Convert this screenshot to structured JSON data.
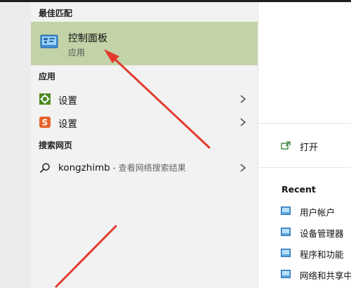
{
  "colors": {
    "best_match_bg": "#c3d3a8",
    "arrow": "#e23b2e",
    "settings_icon": "#4a8a1f",
    "sogou_icon": "#e8622a"
  },
  "sections": {
    "best_match": "最佳匹配",
    "apps": "应用",
    "web_search": "搜索网页"
  },
  "best_match_item": {
    "title": "控制面板",
    "subtitle": "应用",
    "icon": "control-panel-icon"
  },
  "apps": [
    {
      "label": "设置",
      "icon": "settings-gear-icon"
    },
    {
      "label": "设置",
      "icon": "sogou-s-icon"
    }
  ],
  "web_search_item": {
    "query": "kongzhimb",
    "suffix": " - 查看网络搜索结果",
    "icon": "search-icon"
  },
  "right_panel": {
    "open_label": "打开",
    "recent_header": "Recent",
    "recent_items": [
      {
        "label": "用户帐户"
      },
      {
        "label": "设备管理器"
      },
      {
        "label": "程序和功能"
      },
      {
        "label": "网络和共享中"
      }
    ]
  }
}
